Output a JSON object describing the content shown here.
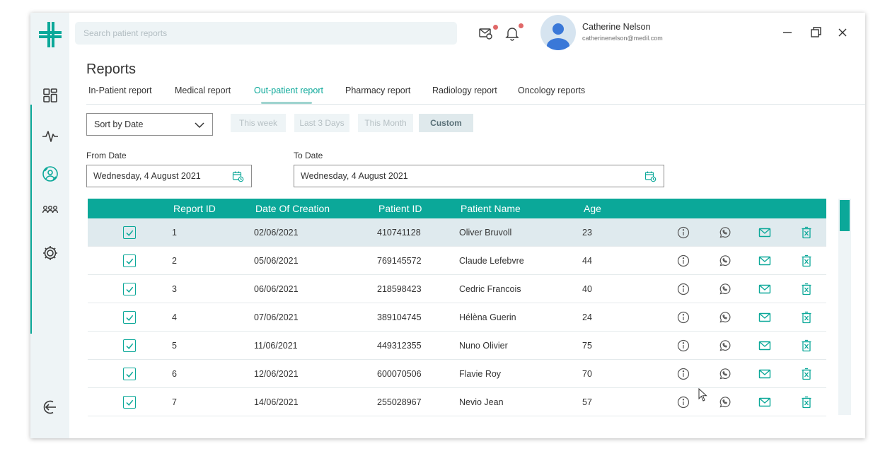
{
  "search": {
    "placeholder": "Search patient reports"
  },
  "user": {
    "name": "Catherine Nelson",
    "email": "catherinenelson@medil.com"
  },
  "page": {
    "title": "Reports"
  },
  "tabs": [
    {
      "label": "In-Patient report",
      "active": false
    },
    {
      "label": "Medical report",
      "active": false
    },
    {
      "label": "Out-patient report",
      "active": true
    },
    {
      "label": "Pharmacy report",
      "active": false
    },
    {
      "label": "Radiology report",
      "active": false
    },
    {
      "label": "Oncology reports",
      "active": false
    }
  ],
  "filters": {
    "sort_value": "Sort by Date",
    "periods": [
      "This week",
      "Last 3 Days",
      "This Month",
      "Custom"
    ],
    "active_period": "Custom",
    "from_label": "From Date",
    "from_value": "Wednesday, 4 August 2021",
    "to_label": "To Date",
    "to_value": "Wednesday, 4 August 2021"
  },
  "table": {
    "columns": [
      "Report ID",
      "Date Of Creation",
      "Patient ID",
      "Patient Name",
      "Age"
    ],
    "rows": [
      {
        "report_id": "1",
        "date": "02/06/2021",
        "patient_id": "410741128",
        "name": "Oliver Bruvoll",
        "age": "23",
        "checked": true,
        "selected": true
      },
      {
        "report_id": "2",
        "date": "05/06/2021",
        "patient_id": "769145572",
        "name": "Claude Lefebvre",
        "age": "44",
        "checked": true,
        "selected": false
      },
      {
        "report_id": "3",
        "date": "06/06/2021",
        "patient_id": "218598423",
        "name": "Cedric Francois",
        "age": "40",
        "checked": true,
        "selected": false
      },
      {
        "report_id": "4",
        "date": "07/06/2021",
        "patient_id": "389104745",
        "name": "Hélèna Guerin",
        "age": "24",
        "checked": true,
        "selected": false
      },
      {
        "report_id": "5",
        "date": "11/06/2021",
        "patient_id": "449312355",
        "name": "Nuno Olivier",
        "age": "75",
        "checked": true,
        "selected": false
      },
      {
        "report_id": "6",
        "date": "12/06/2021",
        "patient_id": "600070506",
        "name": "Flavie Roy",
        "age": "70",
        "checked": true,
        "selected": false
      },
      {
        "report_id": "7",
        "date": "14/06/2021",
        "patient_id": "255028967",
        "name": "Nevio Jean",
        "age": "57",
        "checked": true,
        "selected": false
      }
    ],
    "row_actions": [
      "info-icon",
      "whatsapp-icon",
      "mail-icon",
      "delete-icon"
    ]
  },
  "icons": {
    "logo": "medical-cross-logo",
    "nav": [
      "dashboard-icon",
      "pulse-icon",
      "reports-icon",
      "patients-icon",
      "settings-icon"
    ],
    "logout": "logout-icon",
    "top": [
      "messages-icon",
      "notifications-icon"
    ],
    "window": [
      "minimize-icon",
      "restore-icon",
      "close-icon"
    ]
  },
  "colors": {
    "accent": "#0ba899",
    "notification": "#e06868",
    "selected_row": "#dfeaee",
    "sidebar": "#eef4f6"
  }
}
